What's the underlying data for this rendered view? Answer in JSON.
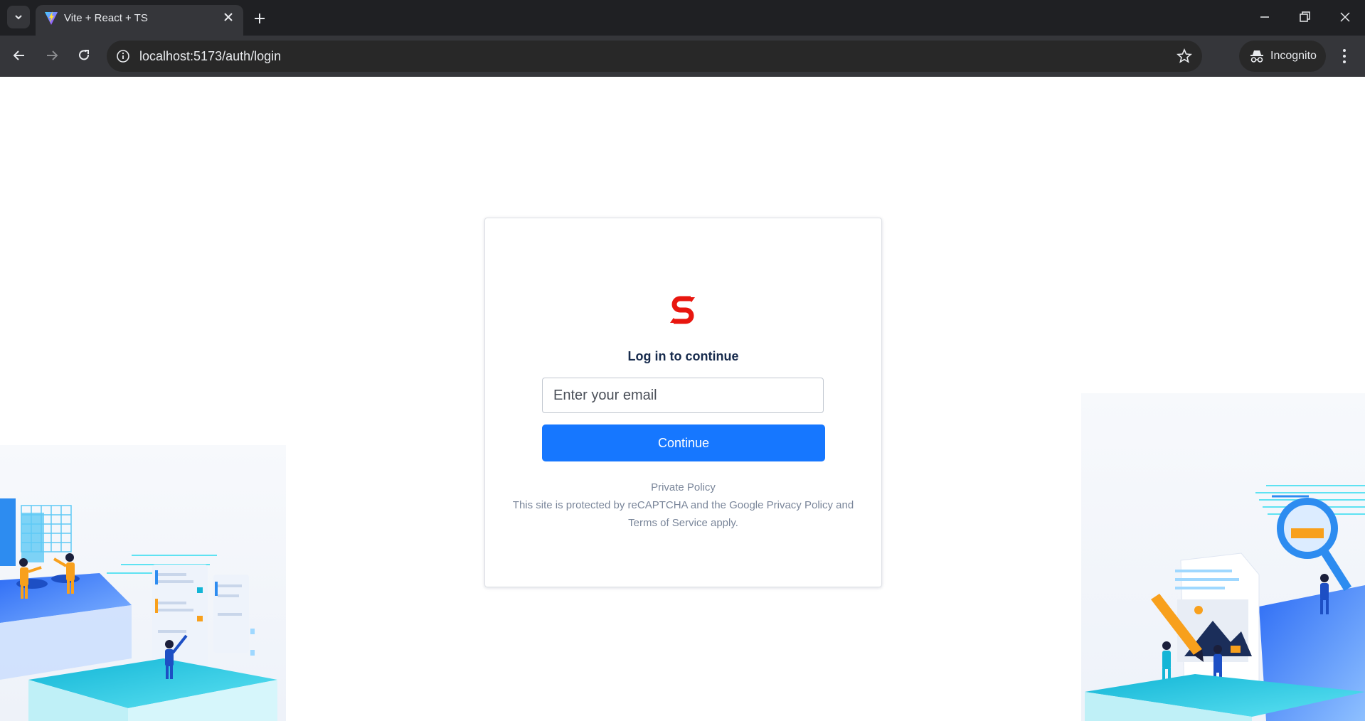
{
  "browser": {
    "tab_title": "Vite + React + TS",
    "url": "localhost:5173/auth/login",
    "incognito_label": "Incognito"
  },
  "login": {
    "heading": "Log in to continue",
    "email_placeholder": "Enter your email",
    "continue_label": "Continue",
    "private_policy_label": "Private Policy",
    "recaptcha_text": "This site is protected by reCAPTCHA and the Google Privacy Policy and Terms of Service apply."
  },
  "colors": {
    "brand_logo": "#e8160f",
    "primary_button": "#1677ff",
    "heading_text": "#172b4d",
    "muted_text": "#7a869a"
  }
}
